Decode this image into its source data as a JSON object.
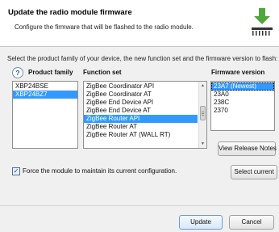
{
  "header": {
    "title": "Update the radio module firmware",
    "subtitle": "Configure the firmware that will be flashed to the radio module."
  },
  "instruction": "Select the product family of your device, the new function set and the firmware version to flash:",
  "help_button_label": "?",
  "columns": {
    "product_family": "Product family",
    "function_set": "Function set",
    "firmware_version": "Firmware version"
  },
  "product_families": [
    {
      "label": "XBP24BSE",
      "selected": false
    },
    {
      "label": "XBP24BZ7",
      "selected": true
    }
  ],
  "function_sets": [
    {
      "label": "ZigBee Coordinator API",
      "selected": false
    },
    {
      "label": "ZigBee Coordinator AT",
      "selected": false
    },
    {
      "label": "ZigBee End Device API",
      "selected": false
    },
    {
      "label": "ZigBee End Device AT",
      "selected": false
    },
    {
      "label": "ZigBee Router API",
      "selected": true
    },
    {
      "label": "ZigBee Router AT",
      "selected": false
    },
    {
      "label": "ZigBee Router AT (WALL RT)",
      "selected": false
    }
  ],
  "firmware_versions": [
    {
      "label": "23A7 (Newest)",
      "selected": true
    },
    {
      "label": "23A0",
      "selected": false
    },
    {
      "label": "238C",
      "selected": false
    },
    {
      "label": "2370",
      "selected": false
    }
  ],
  "buttons": {
    "view_release_notes": "View Release Notes",
    "select_current": "Select current",
    "update": "Update",
    "cancel": "Cancel"
  },
  "force_checkbox": {
    "label": "Force the module to maintain its current configuration.",
    "checked": true
  },
  "colors": {
    "selection": "#3399ff",
    "logo_arrow": "#4fa83d"
  },
  "icons": [
    "help-icon",
    "firmware-download-icon",
    "checkmark-icon",
    "scroll-up-icon",
    "scroll-down-icon"
  ]
}
